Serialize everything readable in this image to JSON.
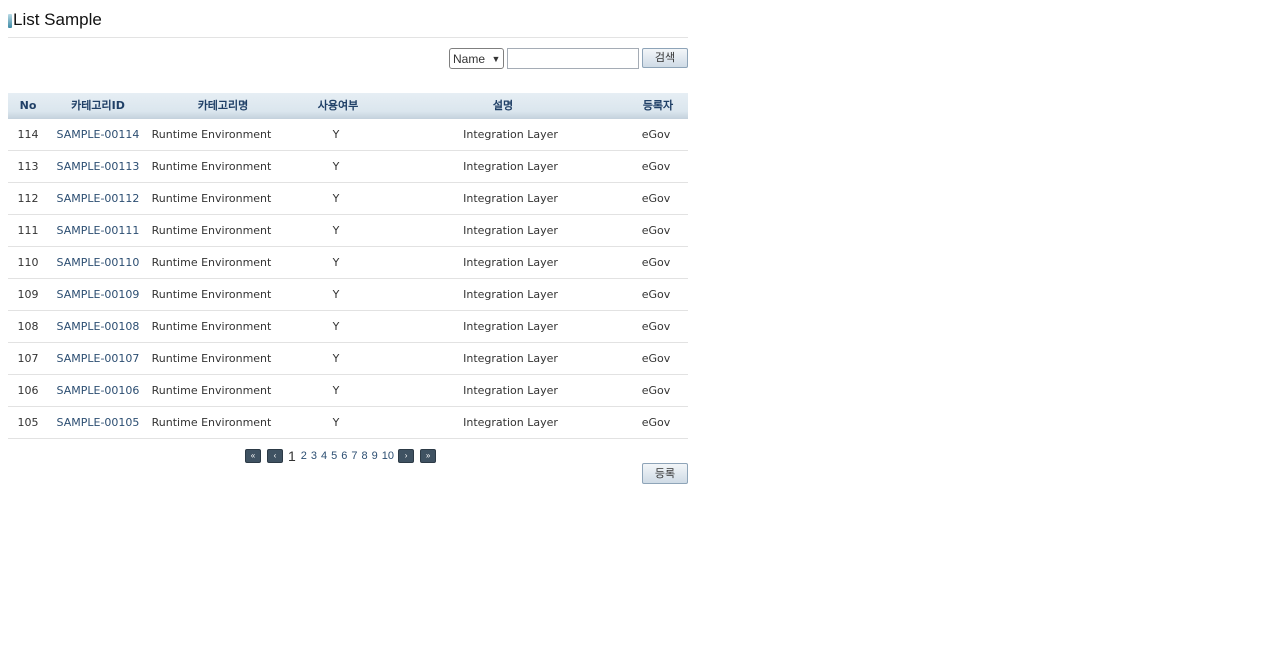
{
  "page": {
    "title": "List Sample"
  },
  "search": {
    "select_value": "Name",
    "input_value": "",
    "button_label": "검색"
  },
  "table": {
    "headers": [
      "No",
      "카테고리ID",
      "카테고리명",
      "사용여부",
      "설명",
      "등록자"
    ],
    "rows": [
      {
        "no": "114",
        "id": "SAMPLE-00114",
        "name": "Runtime Environment",
        "use": "Y",
        "desc": "Integration Layer",
        "reg": "eGov"
      },
      {
        "no": "113",
        "id": "SAMPLE-00113",
        "name": "Runtime Environment",
        "use": "Y",
        "desc": "Integration Layer",
        "reg": "eGov"
      },
      {
        "no": "112",
        "id": "SAMPLE-00112",
        "name": "Runtime Environment",
        "use": "Y",
        "desc": "Integration Layer",
        "reg": "eGov"
      },
      {
        "no": "111",
        "id": "SAMPLE-00111",
        "name": "Runtime Environment",
        "use": "Y",
        "desc": "Integration Layer",
        "reg": "eGov"
      },
      {
        "no": "110",
        "id": "SAMPLE-00110",
        "name": "Runtime Environment",
        "use": "Y",
        "desc": "Integration Layer",
        "reg": "eGov"
      },
      {
        "no": "109",
        "id": "SAMPLE-00109",
        "name": "Runtime Environment",
        "use": "Y",
        "desc": "Integration Layer",
        "reg": "eGov"
      },
      {
        "no": "108",
        "id": "SAMPLE-00108",
        "name": "Runtime Environment",
        "use": "Y",
        "desc": "Integration Layer",
        "reg": "eGov"
      },
      {
        "no": "107",
        "id": "SAMPLE-00107",
        "name": "Runtime Environment",
        "use": "Y",
        "desc": "Integration Layer",
        "reg": "eGov"
      },
      {
        "no": "106",
        "id": "SAMPLE-00106",
        "name": "Runtime Environment",
        "use": "Y",
        "desc": "Integration Layer",
        "reg": "eGov"
      },
      {
        "no": "105",
        "id": "SAMPLE-00105",
        "name": "Runtime Environment",
        "use": "Y",
        "desc": "Integration Layer",
        "reg": "eGov"
      }
    ]
  },
  "pager": {
    "current": "1",
    "pages": [
      "2",
      "3",
      "4",
      "5",
      "6",
      "7",
      "8",
      "9",
      "10"
    ],
    "first_icon": "double-chevron-left-icon",
    "prev_icon": "chevron-left-icon",
    "next_icon": "chevron-right-icon",
    "last_icon": "double-chevron-right-icon"
  },
  "actions": {
    "register_label": "등록"
  },
  "colors": {
    "header_text": "#1f3f66",
    "link_text": "#2c4e72",
    "header_bg": "#dbe6ee"
  }
}
